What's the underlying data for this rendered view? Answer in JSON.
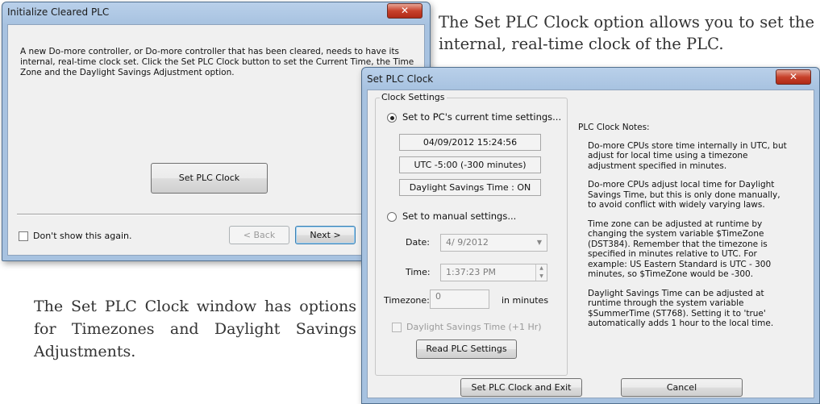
{
  "captions": {
    "top": "The Set PLC Clock option allows you to set the internal, real-time clock of the PLC.",
    "bottom": "The Set PLC Clock window has options for Timezones and Daylight Savings Adjustments."
  },
  "init_window": {
    "title": "Initialize Cleared PLC",
    "close_glyph": "✕",
    "intro": "A new Do-more controller, or Do-more controller that has been cleared, needs to have its internal, real-time clock set. Click the Set PLC Clock button to set the Current Time, the Time Zone and the Daylight Savings Adjustment option.",
    "set_clock_button": "Set PLC Clock",
    "dont_show_label": "Don't show this again.",
    "back_button": "< Back",
    "next_button": "Next >"
  },
  "clock_window": {
    "title": "Set PLC Clock",
    "close_glyph": "✕",
    "group_label": "Clock Settings",
    "pc_time_option": "Set to PC's current time settings...",
    "pc_datetime": "04/09/2012 15:24:56",
    "pc_utc_offset": "UTC -5:00 (-300 minutes)",
    "pc_dst_status": "Daylight Savings Time : ON",
    "manual_option": "Set to manual settings...",
    "date_label": "Date:",
    "date_value": "4/ 9/2012",
    "time_label": "Time:",
    "time_value": "1:37:23 PM",
    "timezone_label": "Timezone:",
    "timezone_value": "0",
    "timezone_unit": "in minutes",
    "dst_checkbox": "Daylight Savings Time (+1 Hr)",
    "read_button": "Read PLC Settings",
    "set_exit_button": "Set PLC Clock and Exit",
    "cancel_button": "Cancel",
    "notes": {
      "heading": "PLC Clock Notes:",
      "paragraphs": [
        "Do-more CPUs store time internally in UTC, but adjust for local time using a timezone adjustment specified in minutes.",
        "Do-more CPUs adjust local time for Daylight Savings Time, but this is only done manually, to avoid conflict with widely varying laws.",
        "Time zone can be adjusted at runtime by changing the system variable $TimeZone (DST384). Remember that the timezone is specified in minutes relative to UTC. For example: US Eastern Standard  is UTC - 300 minutes, so $TimeZone would be -300.",
        "Daylight Savings Time can be adjusted at runtime through the system variable $SummerTime (ST768). Setting it to 'true' automatically adds 1 hour to the local time."
      ]
    }
  }
}
